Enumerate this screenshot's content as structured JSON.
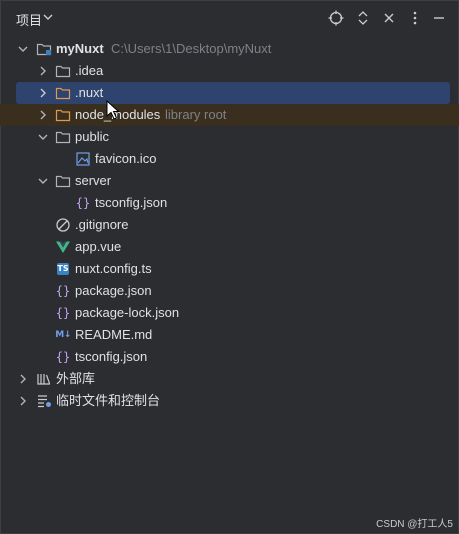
{
  "header": {
    "title": "项目",
    "icons": [
      "chevron-down-icon",
      "locate-icon",
      "expand-collapse-icon",
      "close-icon",
      "more-icon"
    ]
  },
  "tree": {
    "root": {
      "name": "myNuxt",
      "path": "C:\\Users\\1\\Desktop\\myNuxt"
    },
    "idea": ".idea",
    "nuxt": ".nuxt",
    "node_modules": {
      "name": "node_modules",
      "hint": "library root"
    },
    "public": {
      "name": "public",
      "favicon": "favicon.ico"
    },
    "server": {
      "name": "server",
      "tsconfig": "tsconfig.json"
    },
    "gitignore": ".gitignore",
    "app_vue": "app.vue",
    "nuxt_config": "nuxt.config.ts",
    "package_json": "package.json",
    "package_lock": "package-lock.json",
    "readme": "README.md",
    "tsconfig": "tsconfig.json",
    "external_libs": "外部库",
    "scratches": "临时文件和控制台"
  },
  "badges": {
    "ts": "TS",
    "md": "M↓"
  },
  "colors": {
    "background": "#2b2d30",
    "selection": "#2e436e",
    "vue": "#41b883",
    "ts": "#3b82c4"
  },
  "watermark": "CSDN @打工人5"
}
